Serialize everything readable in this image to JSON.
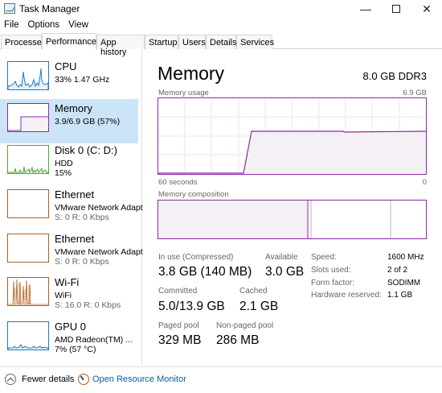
{
  "window": {
    "title": "Task Manager",
    "minimize_glyph": "—",
    "close_glyph": "✕"
  },
  "menu": [
    "File",
    "Options",
    "View"
  ],
  "tabs": [
    "Processes",
    "Performance",
    "App history",
    "Startup",
    "Users",
    "Details",
    "Services"
  ],
  "active_tab": "Performance",
  "sidebar": {
    "items": [
      {
        "name": "CPU",
        "sub": "33% 1.47 GHz",
        "sub2": "",
        "color": "#1a7bc4",
        "icon": "cpu-graph-thumbnail"
      },
      {
        "name": "Memory",
        "sub": "3.9/6.9 GB (57%)",
        "sub2": "",
        "color": "#8b2aa3",
        "icon": "memory-graph-thumbnail"
      },
      {
        "name": "Disk 0 (C: D:)",
        "sub": "HDD",
        "sub2": "15%",
        "color": "#4da832",
        "icon": "disk-graph-thumbnail"
      },
      {
        "name": "Ethernet",
        "sub": "VMware Network Adapt",
        "sub2": "S: 0 R: 0 Kbps",
        "color": "#b35b1e",
        "icon": "ethernet-graph-thumbnail"
      },
      {
        "name": "Ethernet",
        "sub": "VMware Network Adapt",
        "sub2": "S: 0 R: 0 Kbps",
        "color": "#b35b1e",
        "icon": "ethernet-graph-thumbnail"
      },
      {
        "name": "Wi-Fi",
        "sub": "WiFi",
        "sub2": "S: 16.0 R: 0 Kbps",
        "color": "#b35b1e",
        "icon": "wifi-graph-thumbnail"
      },
      {
        "name": "GPU 0",
        "sub": "AMD Radeon(TM) ...",
        "sub2": "7% (57 °C)",
        "color": "#1a7bc4",
        "icon": "gpu-graph-thumbnail"
      }
    ]
  },
  "memory": {
    "title": "Memory",
    "spec": "8.0 GB DDR3",
    "usage_label": "Memory usage",
    "usage_max": "6.9 GB",
    "time_left": "60 seconds",
    "time_right": "0",
    "composition_label": "Memory composition",
    "usage_level": 0.57,
    "stats": {
      "in_use_label": "In use (Compressed)",
      "in_use_value": "3.8 GB (140 MB)",
      "available_label": "Available",
      "available_value": "3.0 GB",
      "committed_label": "Committed",
      "committed_value": "5.0/13.9 GB",
      "cached_label": "Cached",
      "cached_value": "2.1 GB",
      "paged_label": "Paged pool",
      "paged_value": "329 MB",
      "nonpaged_label": "Non-paged pool",
      "nonpaged_value": "286 MB"
    },
    "specs": {
      "speed_label": "Speed:",
      "speed_value": "1600 MHz",
      "slots_label": "Slots used:",
      "slots_value": "2 of 2",
      "form_label": "Form factor:",
      "form_value": "SODIMM",
      "hw_label": "Hardware reserved:",
      "hw_value": "1.1 GB"
    }
  },
  "footer": {
    "fewer_details": "Fewer details",
    "open_monitor": "Open Resource Monitor"
  },
  "colors": {
    "memory_accent": "#8b2aa3",
    "memory_fill": "#f4f0f5",
    "selected_bg": "#cce4f7",
    "link": "#0b5cad"
  }
}
